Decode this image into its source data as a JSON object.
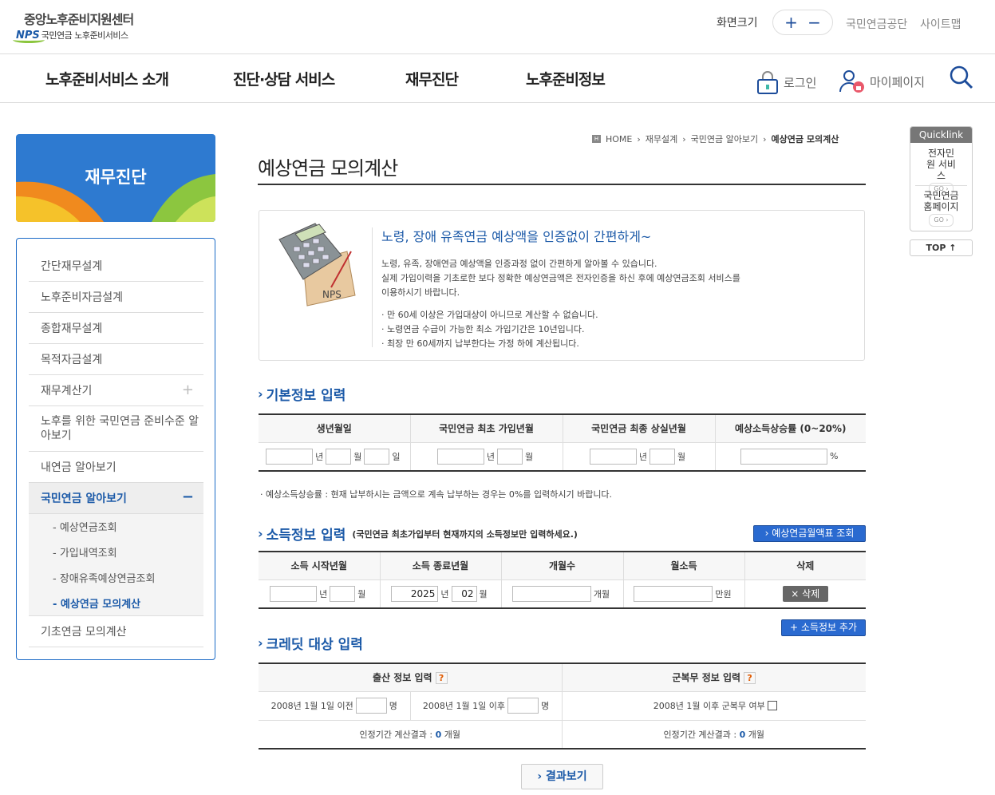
{
  "header": {
    "logo_title": "중앙노후준비지원센터",
    "logo_mark": "NPS",
    "logo_sub": "국민연금 노후준비서비스",
    "fontsize_label": "화면크기",
    "fontsize_plus": "+",
    "fontsize_minus": "−",
    "util_links": [
      "국민연금공단",
      "사이트맵"
    ]
  },
  "nav": {
    "items": [
      "노후준비서비스 소개",
      "진단·상담 서비스",
      "재무진단",
      "노후준비정보"
    ],
    "login": "로그인",
    "mypage": "마이페이지"
  },
  "sidebar": {
    "banner_title": "재무진단",
    "items": [
      "간단재무설계",
      "노후준비자금설계",
      "종합재무설계",
      "목적자금설계",
      "재무계산기",
      "노후를 위한 국민연금 준비수준 알아보기",
      "내연금 알아보기",
      "국민연금 알아보기",
      "기초연금 모의계산"
    ],
    "plus": "+",
    "minus": "−",
    "sub_items": [
      "- 예상연금조회",
      "- 가입내역조회",
      "- 장애유족예상연금조회",
      "- 예상연금 모의계산"
    ]
  },
  "breadcrumb": [
    "HOME",
    "재무설계",
    "국민연금 알아보기",
    "예상연금 모의계산"
  ],
  "page_title": "예상연금 모의계산",
  "intro": {
    "headline": "노령, 장애 유족연금 예상액을 인증없이 간편하게~",
    "para1": "노령, 유족, 장애연금 예상액을 인증과정 없이 간편하게 알아볼 수 있습니다.",
    "para2": "실제 가입이력을 기초로한 보다 정확한 예상연금액은 전자인증을 하신 후에 예상연금조회 서비스를",
    "para3": "이용하시기 바랍니다.",
    "bullet1": "· 만 60세 이상은 가입대상이 아니므로 계산할 수 없습니다.",
    "bullet2": "· 노령연금 수급이 가능한 최소 가입기간은 10년입니다.",
    "bullet3": "· 최장 만 60세까지 납부한다는 가정 하에 계산됩니다.",
    "image_label": "NPS"
  },
  "basic": {
    "title": "기본정보 입력",
    "headers": [
      "생년월일",
      "국민연금 최초 가입년월",
      "국민연금 최종 상실년월",
      "예상소득상승률 (0~20%)"
    ],
    "unit_year": "년",
    "unit_month": "월",
    "unit_day": "일",
    "unit_pct": "%",
    "note": "· 예상소득상승률 : 현재 납부하시는 금액으로 계속 납부하는 경우는 0%를 입력하시기 바랍니다."
  },
  "income": {
    "title": "소득정보 입력",
    "subtitle": "(국민연금 최초가입부터 현재까지의 소득정보만 입력하세요.)",
    "table_btn": "› 예상연금월액표 조회",
    "headers": [
      "소득 시작년월",
      "소득 종료년월",
      "개월수",
      "월소득",
      "삭제"
    ],
    "end_year": "2025",
    "end_month": "02",
    "unit_months": "개월",
    "unit_manwon": "만원",
    "delete_btn": "× 삭제",
    "add_btn": "+ 소득정보 추가"
  },
  "credit": {
    "title": "크레딧 대상 입력",
    "birth_header": "출산 정보 입력",
    "military_header": "군복무 정보 입력",
    "help": "?",
    "before": "2008년 1월 1일 이전",
    "after": "2008년 1월 1일 이후",
    "unit_people": "명",
    "military_label": "2008년 1월 이후 군복무 여부",
    "result_label": "인정기간 계산결과 :",
    "result_value": "0",
    "result_unit": "개월"
  },
  "quicklink": {
    "title": "Quicklink",
    "items": [
      "전자민원 서비스",
      "국민연금 홈페이지"
    ],
    "go": "GO ›",
    "top": "TOP ↑"
  },
  "result_button": "› 결과보기"
}
